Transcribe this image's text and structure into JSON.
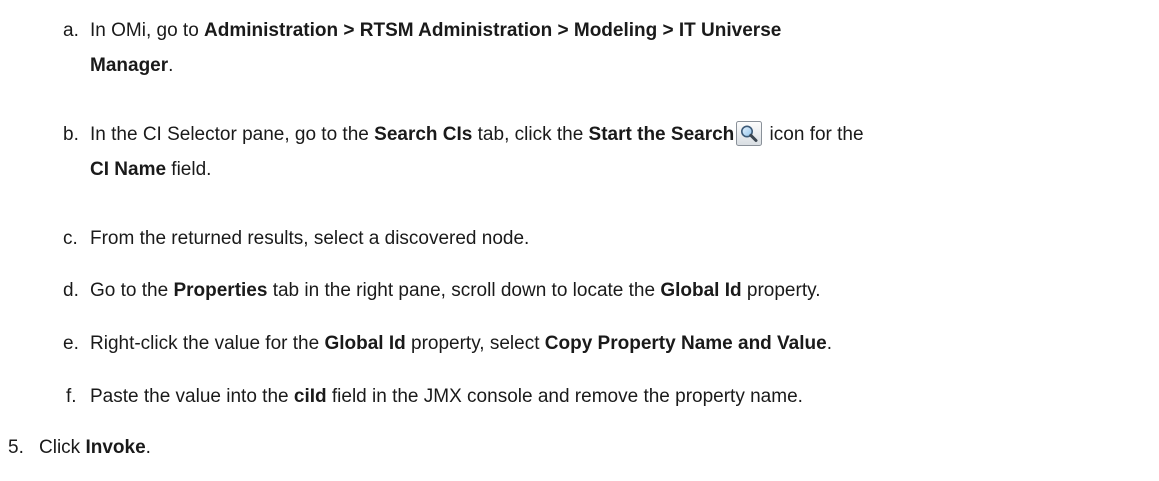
{
  "steps": [
    {
      "marker": "a.",
      "line1": [
        {
          "t": "In OMi, go to ",
          "b": false
        },
        {
          "t": "Administration > RTSM Administration > Modeling > IT Universe",
          "b": true
        }
      ],
      "line2": [
        {
          "t": "Manager",
          "b": true
        },
        {
          "t": ".",
          "b": false
        }
      ]
    },
    {
      "marker": "b.",
      "line1_pre": [
        {
          "t": "In the CI Selector pane, go to the ",
          "b": false
        },
        {
          "t": "Search CIs",
          "b": true
        },
        {
          "t": " tab, click the ",
          "b": false
        },
        {
          "t": "Start the Search",
          "b": true
        }
      ],
      "icon": "search-icon",
      "line1_post": [
        {
          "t": " icon for the",
          "b": false
        }
      ],
      "line2": [
        {
          "t": "CI Name",
          "b": true
        },
        {
          "t": " field.",
          "b": false
        }
      ]
    },
    {
      "marker": "c.",
      "line1": [
        {
          "t": "From the returned results, select a discovered node.",
          "b": false
        }
      ]
    },
    {
      "marker": "d.",
      "line1": [
        {
          "t": "Go to the ",
          "b": false
        },
        {
          "t": "Properties",
          "b": true
        },
        {
          "t": " tab in the right pane, scroll down to locate the ",
          "b": false
        },
        {
          "t": "Global Id",
          "b": true
        },
        {
          "t": " property.",
          "b": false
        }
      ]
    },
    {
      "marker": "e.",
      "line1": [
        {
          "t": "Right-click the value for the ",
          "b": false
        },
        {
          "t": "Global Id",
          "b": true
        },
        {
          "t": " property, select ",
          "b": false
        },
        {
          "t": "Copy Property Name and Value",
          "b": true
        },
        {
          "t": ".",
          "b": false
        }
      ]
    },
    {
      "marker": "f.",
      "line1": [
        {
          "t": "Paste the value into the ",
          "b": false
        },
        {
          "t": "ciId",
          "b": true
        },
        {
          "t": " field in the JMX console and remove the property name.",
          "b": false
        }
      ]
    },
    {
      "marker": "5.",
      "line1": [
        {
          "t": "Click ",
          "b": false
        },
        {
          "t": "Invoke",
          "b": true
        },
        {
          "t": ".",
          "b": false
        }
      ]
    }
  ]
}
